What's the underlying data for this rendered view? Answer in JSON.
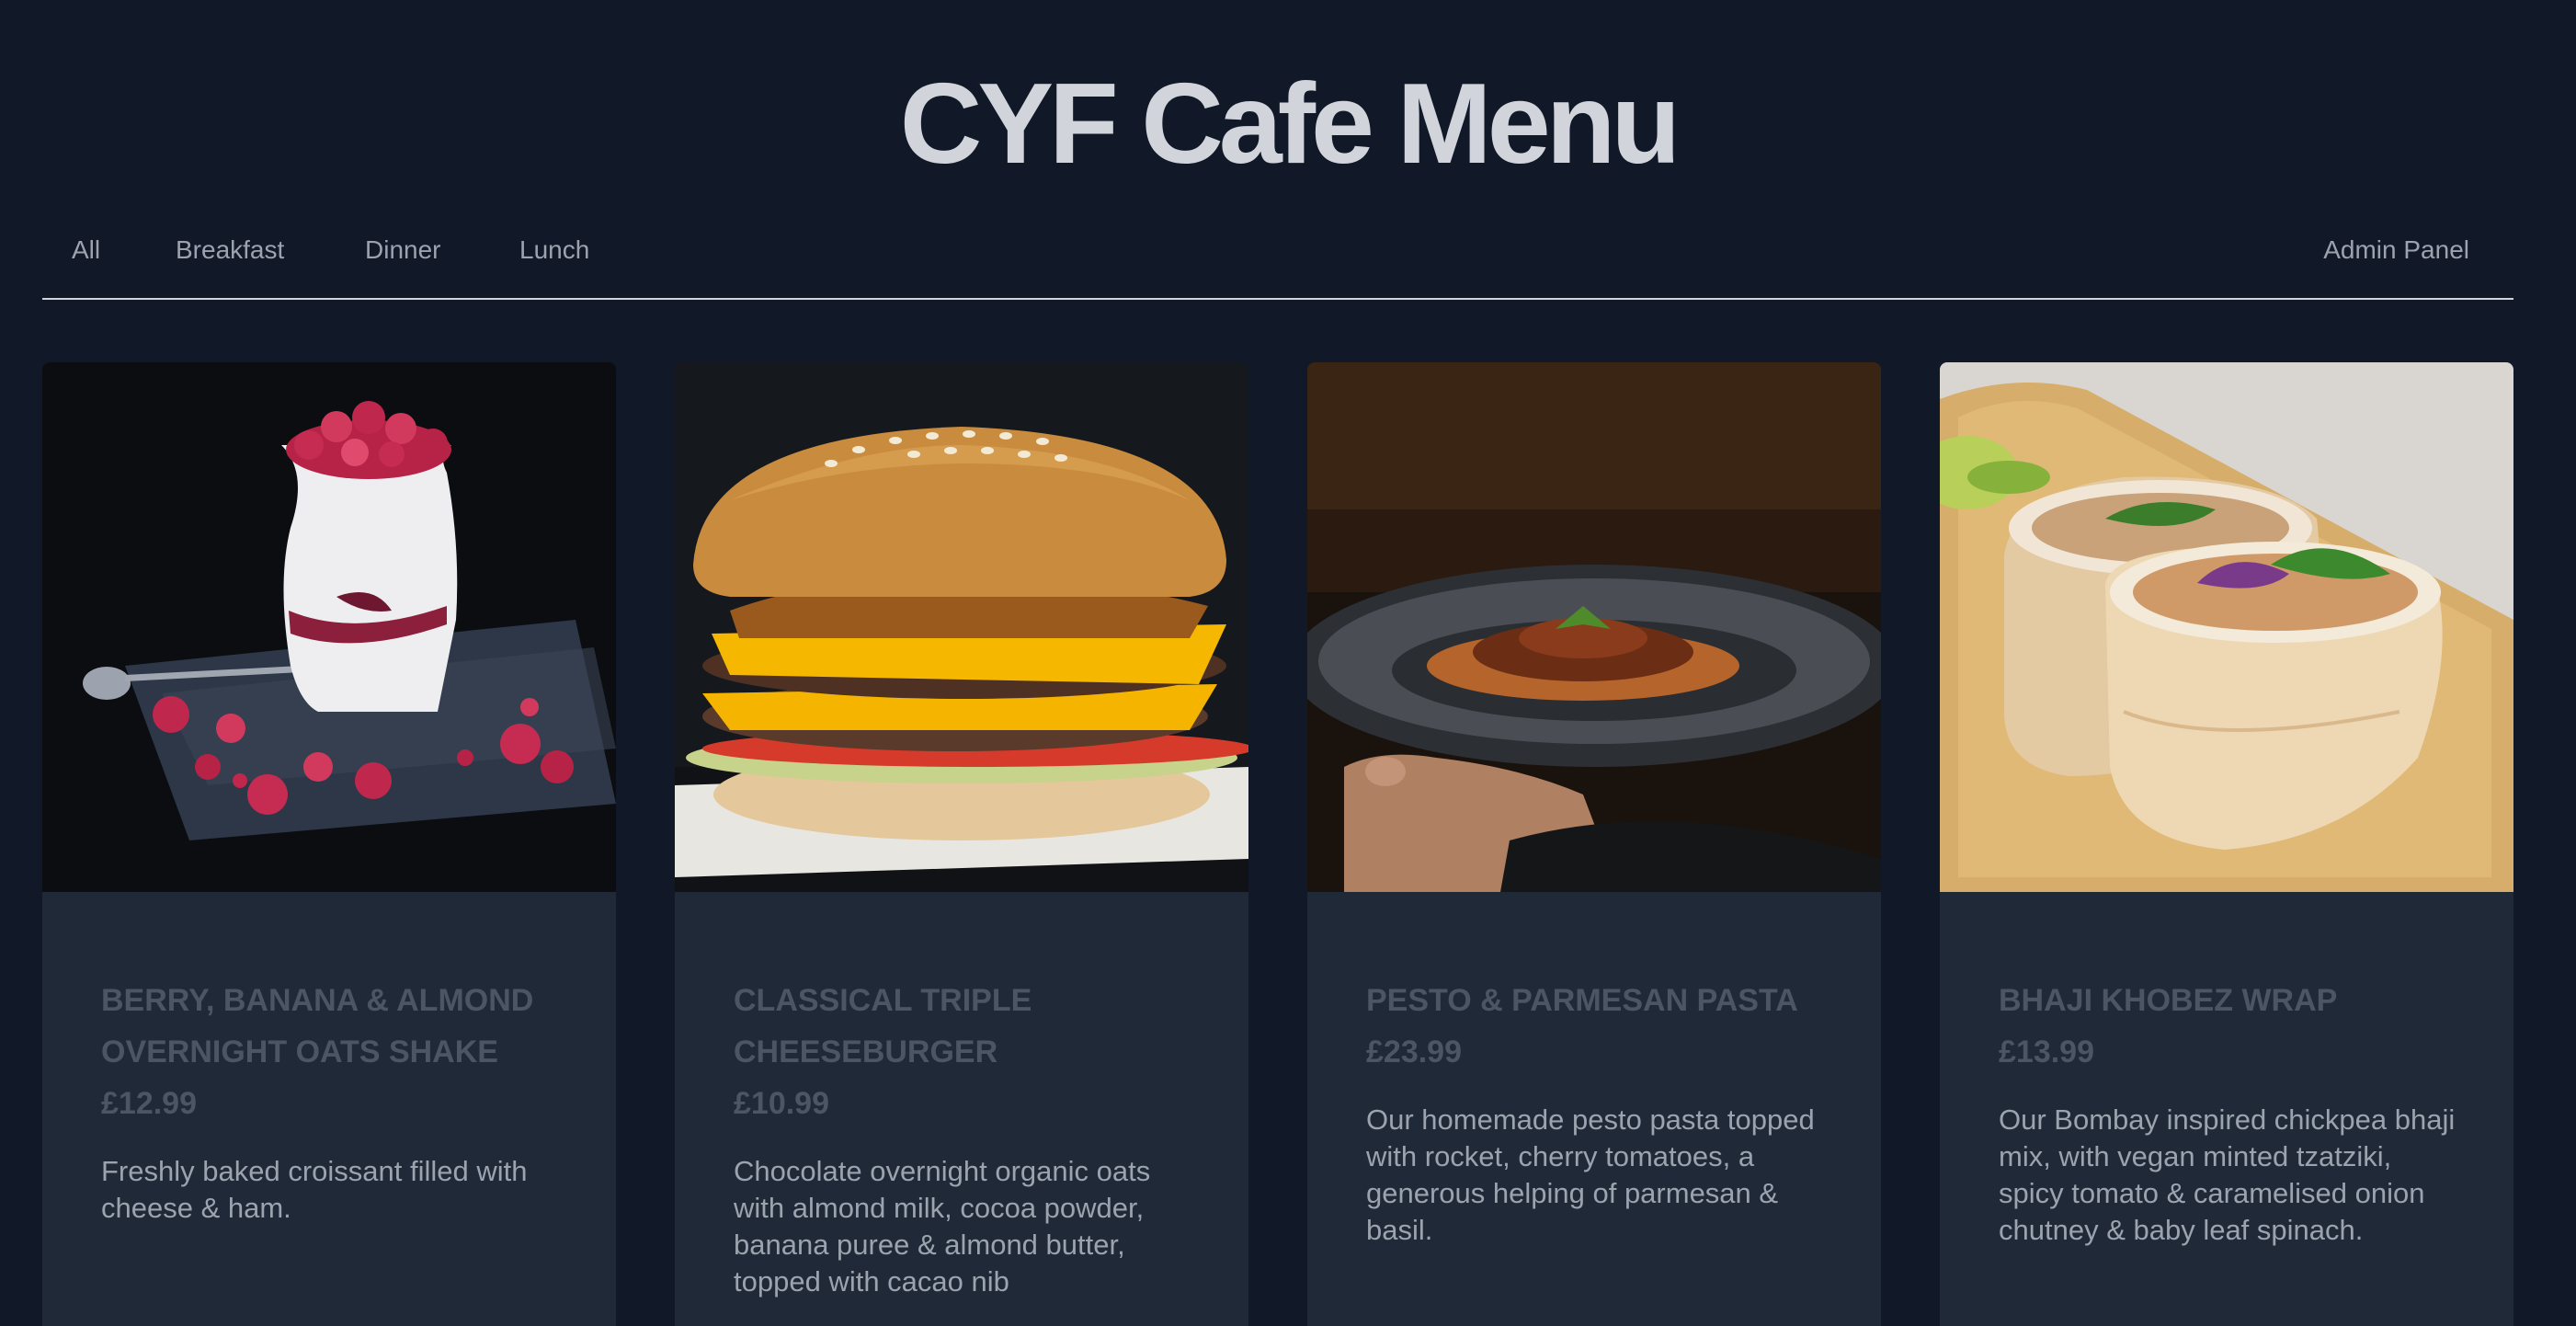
{
  "header": {
    "title": "CYF Cafe Menu"
  },
  "nav": {
    "all": "All",
    "breakfast": "Breakfast",
    "dinner": "Dinner",
    "lunch": "Lunch",
    "admin": "Admin Panel"
  },
  "menu": {
    "items": [
      {
        "name": "BERRY, BANANA & ALMOND OVERNIGHT OATS SHAKE",
        "price": "£12.99",
        "description": "Freshly baked croissant filled with cheese & ham.",
        "image_alt": "Berry banana almond overnight oats shake"
      },
      {
        "name": "CLASSICAL TRIPLE CHEESEBURGER",
        "price": "£10.99",
        "description": "Chocolate overnight organic oats with almond milk, cocoa powder, banana puree & almond butter, topped with cacao nib",
        "image_alt": "Classical triple cheeseburger"
      },
      {
        "name": "PESTO & PARMESAN PASTA",
        "price": "£23.99",
        "description": "Our homemade pesto pasta topped with rocket, cherry tomatoes, a generous helping of parmesan & basil.",
        "image_alt": "Pesto and parmesan pasta"
      },
      {
        "name": "BHAJI KHOBEZ WRAP",
        "price": "£13.99",
        "description": "Our Bombay inspired chickpea bhaji mix, with vegan minted tzatziki, spicy tomato & caramelised onion chutney & baby leaf spinach.",
        "image_alt": "Bhaji khobez wrap"
      }
    ]
  },
  "colors": {
    "page_background": "#111827",
    "card_background": "#1f2937",
    "title_text": "#d1d5db",
    "nav_text": "#9ca3af",
    "card_heading_text": "#4b5563",
    "card_body_text": "#9ca3af"
  },
  "icons": {
    "image_1": "milkshake-image",
    "image_2": "cheeseburger-image",
    "image_3": "pasta-image",
    "image_4": "wrap-image"
  }
}
